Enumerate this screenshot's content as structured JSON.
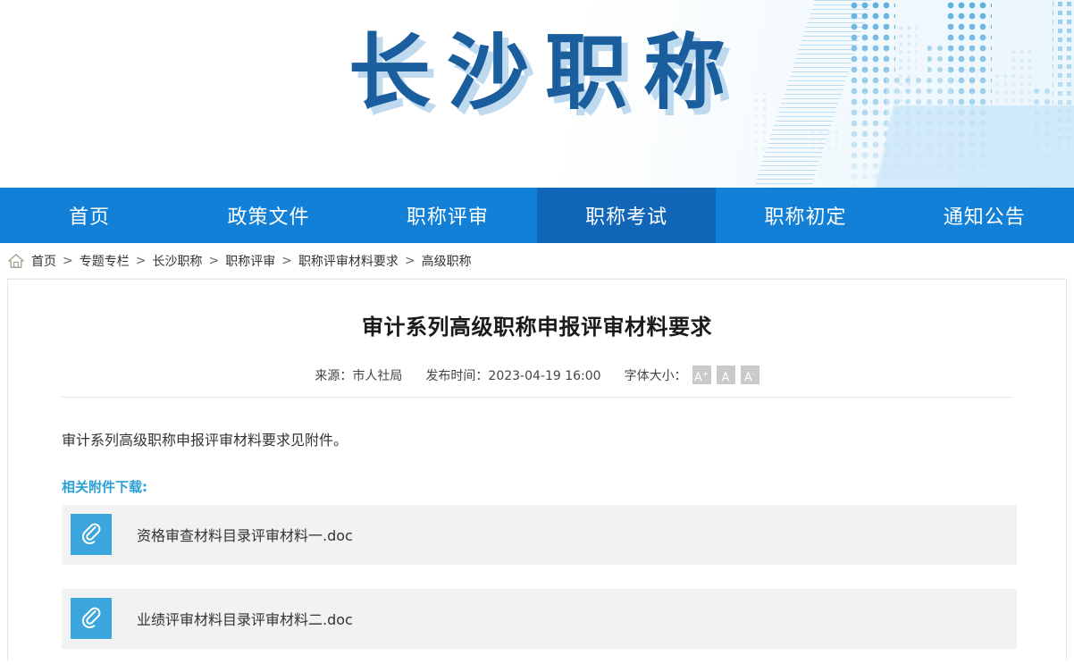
{
  "banner": {
    "site_title": "长沙职称"
  },
  "nav": {
    "items": [
      {
        "label": "首页",
        "active": false
      },
      {
        "label": "政策文件",
        "active": false
      },
      {
        "label": "职称评审",
        "active": false
      },
      {
        "label": "职称考试",
        "active": true
      },
      {
        "label": "职称初定",
        "active": false
      },
      {
        "label": "通知公告",
        "active": false
      }
    ]
  },
  "breadcrumb": {
    "home_icon": "home-icon",
    "separator": ">",
    "items": [
      "首页",
      "专题专栏",
      "长沙职称",
      "职称评审",
      "职称评审材料要求",
      "高级职称"
    ]
  },
  "article": {
    "title": "审计系列高级职称申报评审材料要求",
    "source_label": "来源：",
    "source_value": "市人社局",
    "publish_label": "发布时间：",
    "publish_value": "2023-04-19 16:00",
    "font_size_label": "字体大小：",
    "font_size_buttons": [
      {
        "name": "font-size-increase",
        "glyph": "A",
        "mark": "+"
      },
      {
        "name": "font-size-default",
        "glyph": "A",
        "mark": ""
      },
      {
        "name": "font-size-decrease",
        "glyph": "A",
        "mark": "-"
      }
    ],
    "body": "审计系列高级职称申报评审材料要求见附件。",
    "attachments_label": "相关附件下载:",
    "attachments": [
      {
        "name": "资格审查材料目录评审材料一.doc",
        "icon": "paperclip-icon"
      },
      {
        "name": "业绩评审材料目录评审材料二.doc",
        "icon": "paperclip-icon"
      }
    ]
  },
  "colors": {
    "nav_bg": "#1380d8",
    "nav_active_bg": "#1266b8",
    "brand_title": "#1a5e9e",
    "brand_title_shadow": "#aacee9",
    "attachment_link": "#2a9fd6",
    "attachment_row_bg": "#f2f2f2",
    "attachment_icon_bg": "#3aa6dd",
    "font_size_btn_bg": "#c9c9c9"
  }
}
